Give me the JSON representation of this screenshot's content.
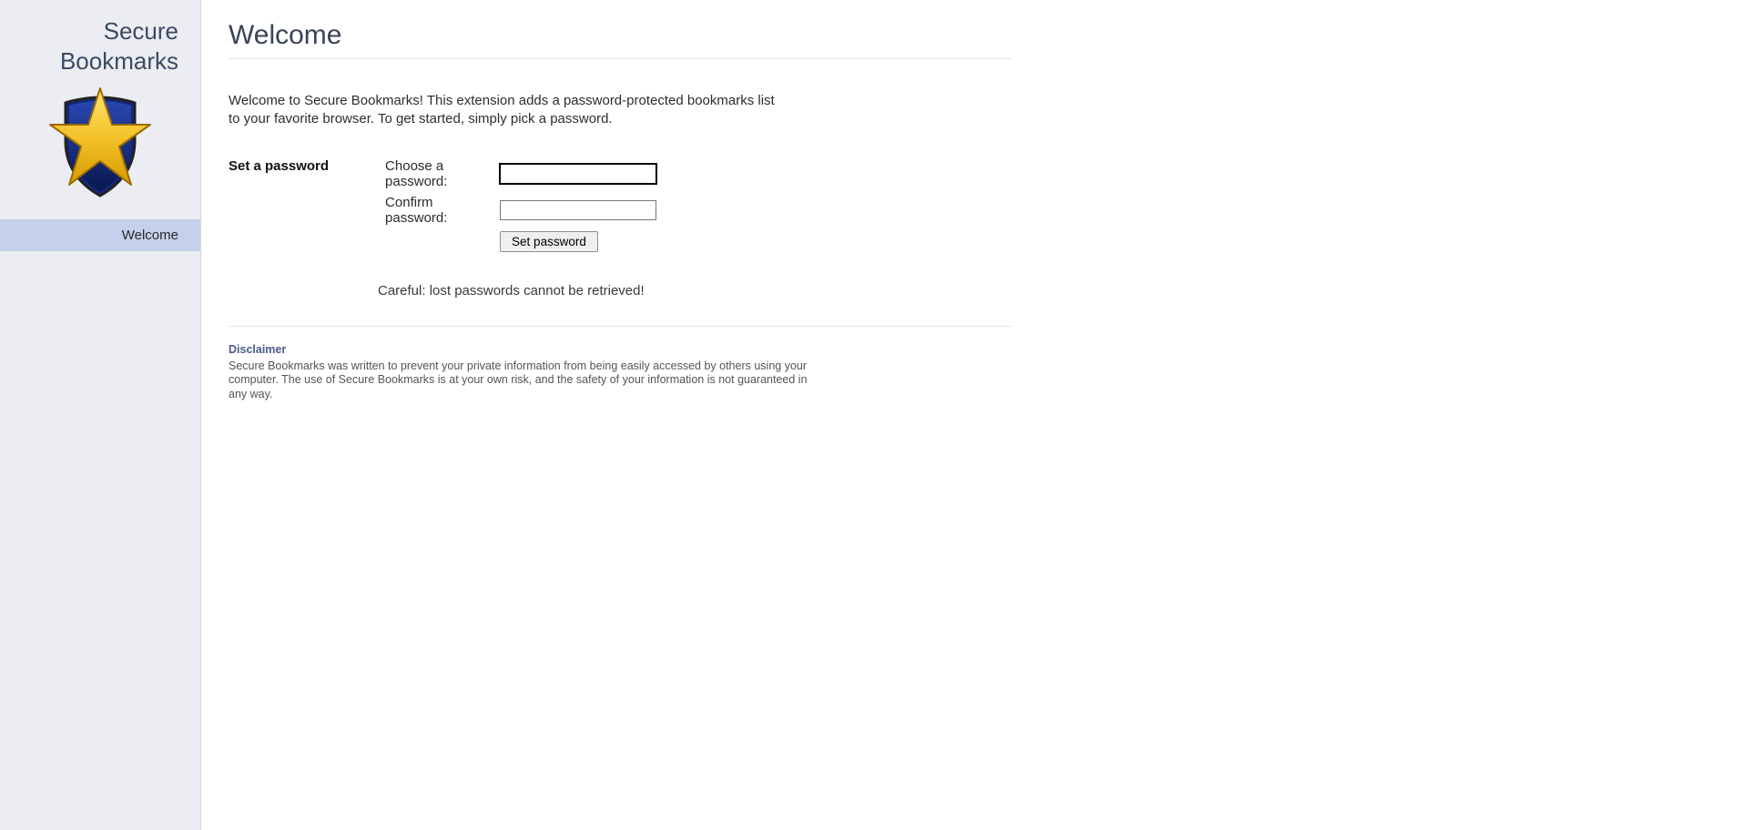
{
  "sidebar": {
    "brand_line1": "Secure",
    "brand_line2": "Bookmarks",
    "nav": [
      {
        "label": "Welcome"
      }
    ]
  },
  "main": {
    "title": "Welcome",
    "intro": "Welcome to Secure Bookmarks! This extension adds a password-protected bookmarks list to your favorite browser. To get started, simply pick a password.",
    "section_label": "Set a password",
    "field_choose_label": "Choose a password:",
    "field_confirm_label": "Confirm password:",
    "choose_value": "",
    "confirm_value": "",
    "set_button": "Set password",
    "warning": "Careful: lost passwords cannot be retrieved!",
    "disclaimer_heading": "Disclaimer",
    "disclaimer_body": "Secure Bookmarks was written to prevent your private information from being easily accessed by others using your computer. The use of Secure Bookmarks is at your own risk, and the safety of your information is not guaranteed in any way."
  }
}
